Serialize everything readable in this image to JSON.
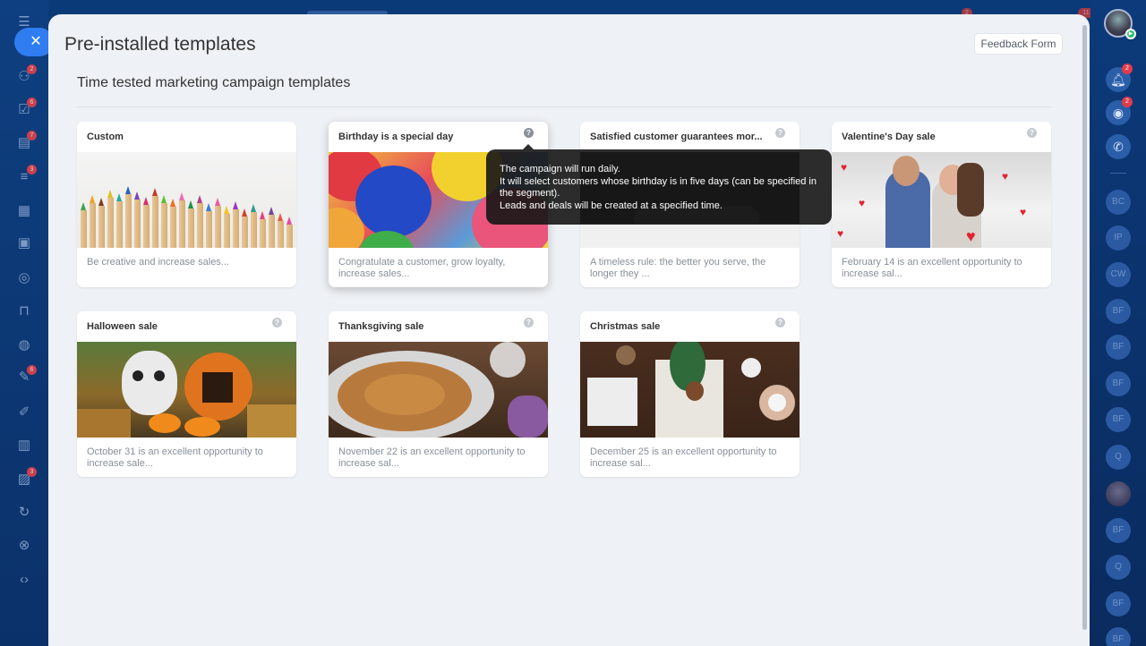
{
  "panel": {
    "title": "Pre-installed templates",
    "feedback_button": "Feedback Form",
    "subtitle": "Time tested marketing campaign templates"
  },
  "left_rail": {
    "close_icon": "close-icon",
    "badges": [
      "2",
      "6",
      "7",
      "3",
      "6",
      "3"
    ]
  },
  "right_rail": {
    "notification_badge": "2",
    "activity_badge": "2",
    "users": [
      "BC",
      "IP",
      "CW",
      "BF",
      "BF",
      "BF",
      "BF",
      "Q",
      "BF",
      "Q",
      "BF",
      "BF"
    ]
  },
  "top_badges": [
    "2",
    "11"
  ],
  "templates": [
    {
      "title": "Custom",
      "description": "Be creative and increase sales...",
      "has_help": false
    },
    {
      "title": "Birthday is a special day",
      "description": "Congratulate a customer, grow loyalty, increase sales...",
      "has_help": true
    },
    {
      "title": "Satisfied customer guarantees mor...",
      "description": "A timeless rule: the better you serve, the longer they ...",
      "has_help": true
    },
    {
      "title": "Valentine's Day sale",
      "description": "February 14 is an excellent opportunity to increase sal...",
      "has_help": true
    },
    {
      "title": "Halloween sale",
      "description": "October 31 is an excellent opportunity to increase sale...",
      "has_help": true
    },
    {
      "title": "Thanksgiving sale",
      "description": "November 22 is an excellent opportunity to increase sal...",
      "has_help": true
    },
    {
      "title": "Christmas sale",
      "description": "December 25 is an excellent opportunity to increase sal...",
      "has_help": true
    }
  ],
  "tooltip": {
    "line1": "The campaign will run daily.",
    "line2": "It will select customers whose birthday is in five days (can be specified in the segment).",
    "line3": "Leads and deals will be created at a specified time."
  },
  "colors": {
    "accent": "#2f7df0",
    "background": "#0b3a78",
    "panel": "#eef1f5"
  }
}
